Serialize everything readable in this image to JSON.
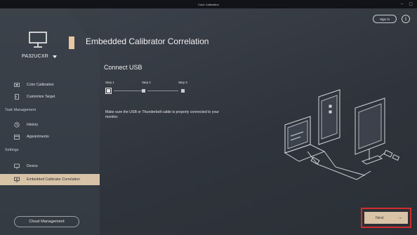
{
  "titlebar": {
    "title": "Color Calibration",
    "minimize": "–",
    "maximize": "▢"
  },
  "sidebar": {
    "device_name": "PA32UCXR",
    "items_top": [
      {
        "label": "Color Calibration",
        "icon": "calibration-icon"
      },
      {
        "label": "Customize Target",
        "icon": "target-icon"
      }
    ],
    "task_section": "Task Management",
    "task_items": [
      {
        "label": "History",
        "icon": "history-icon"
      },
      {
        "label": "Appointments",
        "icon": "calendar-icon"
      }
    ],
    "settings_section": "Settings",
    "settings_items": [
      {
        "label": "Device",
        "icon": "monitor-icon"
      },
      {
        "label": "Embedded Calibrator Correlation",
        "icon": "calibrator-icon",
        "active": true
      }
    ],
    "cloud_button": "Cloud Management"
  },
  "header": {
    "title": "Embedded Calibrator Correlation",
    "sign_in": "Sign in",
    "info": "i"
  },
  "main": {
    "step_title": "Connect USB",
    "steps": [
      "Step 1",
      "Step 2",
      "Step 3"
    ],
    "current_step": 1,
    "instruction": "Make sure the USB or Thunderbolt cable is properly connected to your monitor.",
    "next_label": "Next",
    "next_arrow": "→"
  },
  "colors": {
    "accent": "#d9c3a6",
    "highlight_border": "#d42c2c",
    "bg": "#2f343c"
  }
}
